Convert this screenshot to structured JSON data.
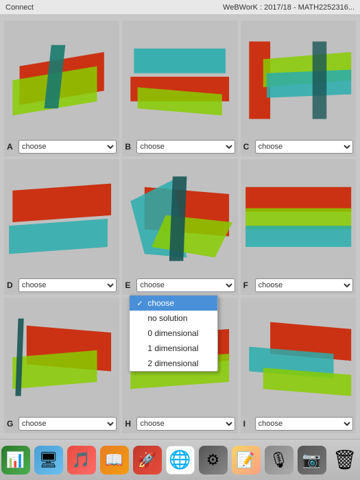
{
  "topBar": {
    "leftText": "Connect",
    "rightText": "WeBWorK : 2017/18 - MATH2252316..."
  },
  "cells": [
    {
      "letter": "A",
      "id": "a"
    },
    {
      "letter": "B",
      "id": "b"
    },
    {
      "letter": "C",
      "id": "c"
    },
    {
      "letter": "D",
      "id": "d"
    },
    {
      "letter": "E",
      "id": "e"
    },
    {
      "letter": "F",
      "id": "f"
    },
    {
      "letter": "G",
      "id": "g"
    },
    {
      "letter": "H",
      "id": "h"
    },
    {
      "letter": "I",
      "id": "i"
    }
  ],
  "selectOptions": [
    "choose",
    "no solution",
    "0 dimensional",
    "1 dimensional",
    "2 dimensional"
  ],
  "defaultValue": "choose",
  "dropdown": {
    "items": [
      {
        "label": "choose",
        "selected": true
      },
      {
        "label": "no solution",
        "selected": false
      },
      {
        "label": "0 dimensional",
        "selected": false
      },
      {
        "label": "1 dimensional",
        "selected": false
      },
      {
        "label": "2 dimensional",
        "selected": false
      }
    ]
  },
  "dock": {
    "icons": [
      "📊",
      "🖥",
      "🎵",
      "📖",
      "🚀",
      "🌐",
      "⚙",
      "📝",
      "🎙",
      "📷",
      "🗑"
    ]
  }
}
